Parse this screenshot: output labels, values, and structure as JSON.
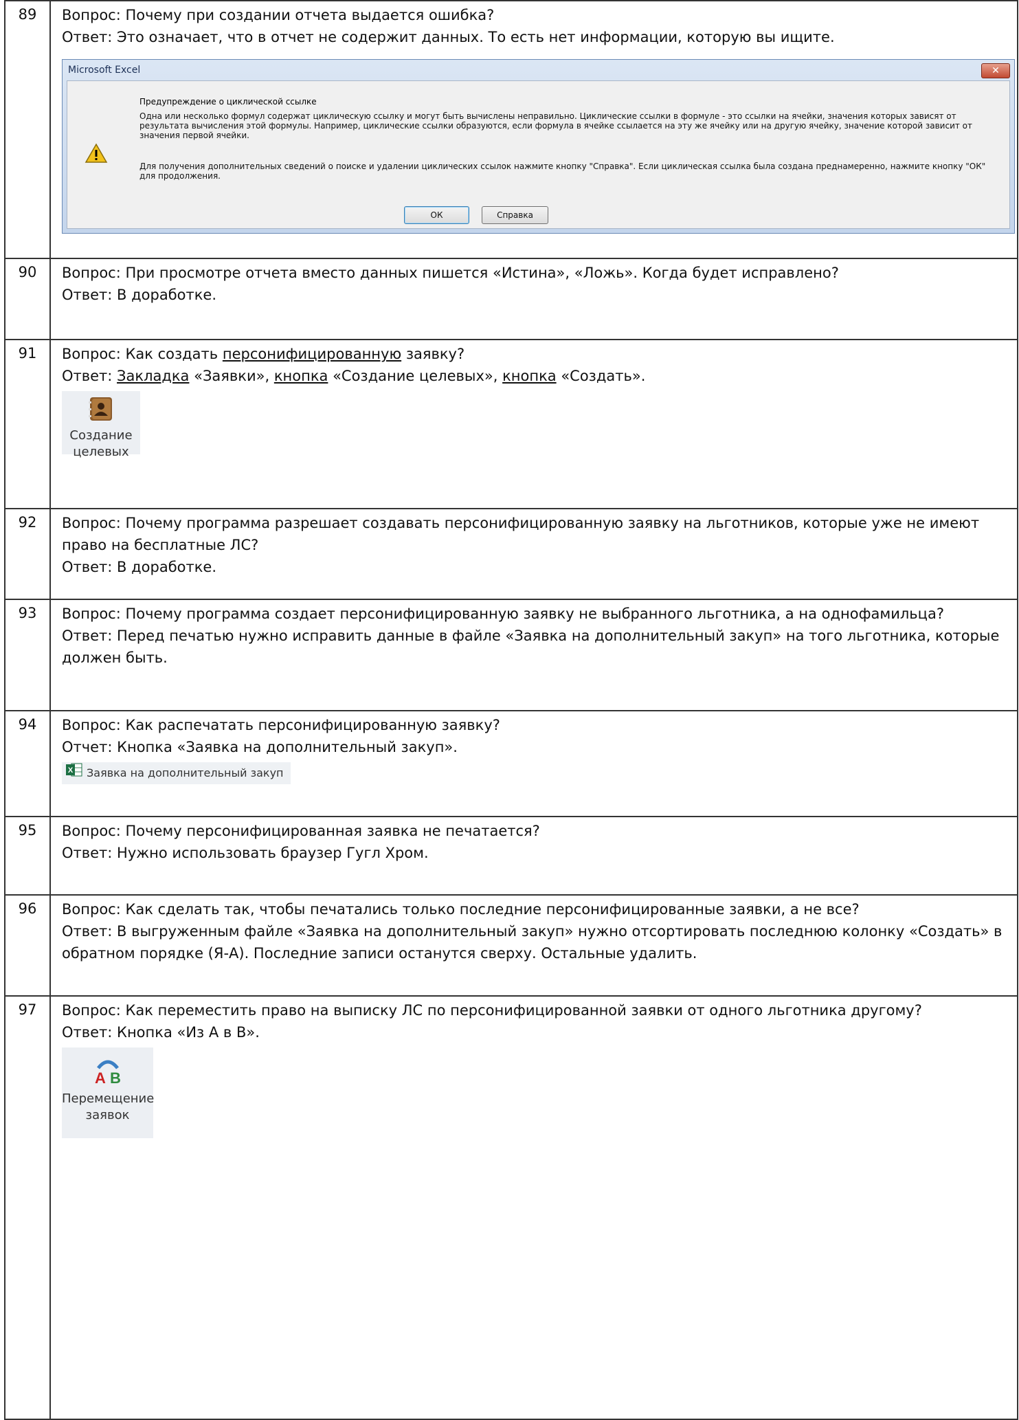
{
  "rows": [
    {
      "num": "89",
      "question": "Вопрос: Почему при создании отчета выдается ошибка?",
      "answer": "Ответ: Это означает, что в отчет не содержит данных. То есть нет информации, которую вы ищите.",
      "dialog": {
        "title": "Microsoft Excel",
        "heading": "Предупреждение о циклической ссылке",
        "text1": "Одна или несколько формул содержат циклическую ссылку и могут быть вычислены неправильно. Циклические ссылки в формуле - это ссылки на ячейки, значения которых зависят от результата вычисления этой формулы. Например, циклические ссылки образуются, если формула в ячейке ссылается на эту же ячейку или на другую ячейку, значение которой зависит от значения первой ячейки.",
        "text2": "Для получения дополнительных сведений о поиске и удалении циклических ссылок нажмите кнопку \"Справка\". Если циклическая ссылка была создана преднамеренно, нажмите кнопку \"ОК\" для продолжения.",
        "ok_label": "ОК",
        "help_label": "Справка"
      }
    },
    {
      "num": "90",
      "question": "Вопрос: При просмотре отчета вместо данных пишется «Истина», «Ложь». Когда будет исправлено?",
      "answer": "Ответ: В доработке."
    },
    {
      "num": "91",
      "question_prefix": "Вопрос: Как создать ",
      "question_link": "персонифицированную",
      "question_suffix": " заявку?",
      "answer_prefix": "Ответ: ",
      "answer_link1": "Закладка",
      "answer_mid1": " «Заявки», ",
      "answer_link2": "кнопка",
      "answer_mid2": " «Создание целевых», ",
      "answer_link3": "кнопка",
      "answer_suffix": " «Создать».",
      "button_line1": "Создание",
      "button_line2": "целевых"
    },
    {
      "num": "92",
      "question": "Вопрос: Почему программа разрешает создавать персонифицированную заявку на льготников, которые уже не имеют право на бесплатные ЛС?",
      "answer": "Ответ: В доработке."
    },
    {
      "num": "93",
      "question": "Вопрос: Почему программа создает персонифицированную заявку не выбранного льготника, а на однофамильца?",
      "answer": "Ответ: Перед печатью нужно исправить данные в файле «Заявка на дополнительный закуп» на того льготника, которые должен быть."
    },
    {
      "num": "94",
      "question": "Вопрос: Как распечатать персонифицированную заявку?",
      "answer": "Отчет: Кнопка «Заявка на дополнительный закуп».",
      "button_label": "Заявка на дополнительный закуп"
    },
    {
      "num": "95",
      "question": "Вопрос: Почему персонифицированная заявка не печатается?",
      "answer": "Ответ: Нужно использовать браузер Гугл Хром."
    },
    {
      "num": "96",
      "question": "Вопрос: Как сделать так, чтобы печатались только последние персонифицированные заявки, а не все?",
      "answer": "Ответ: В выгруженным файле «Заявка на дополнительный закуп» нужно отсортировать последнюю колонку «Создать» в обратном порядке (Я-А). Последние записи останутся сверху. Остальные удалить."
    },
    {
      "num": "97",
      "question": "Вопрос: Как переместить право на выписку ЛС по персонифицированной заявки от одного льготника другому?",
      "answer": "Ответ: Кнопка «Из А в В».",
      "icon_letters": "A B",
      "button_line1": "Перемещение",
      "button_line2": "заявок"
    }
  ],
  "colors": {
    "border": "#333333",
    "excel_icon": "#1d7044",
    "addressbook_icon": "#8a5a2b",
    "ab_red": "#cc2222",
    "ab_green": "#2e8b3e",
    "ab_arc": "#3b7fc4"
  },
  "icons": [
    "warning-icon",
    "close-icon",
    "address-book-icon",
    "excel-icon",
    "ab-move-icon"
  ]
}
